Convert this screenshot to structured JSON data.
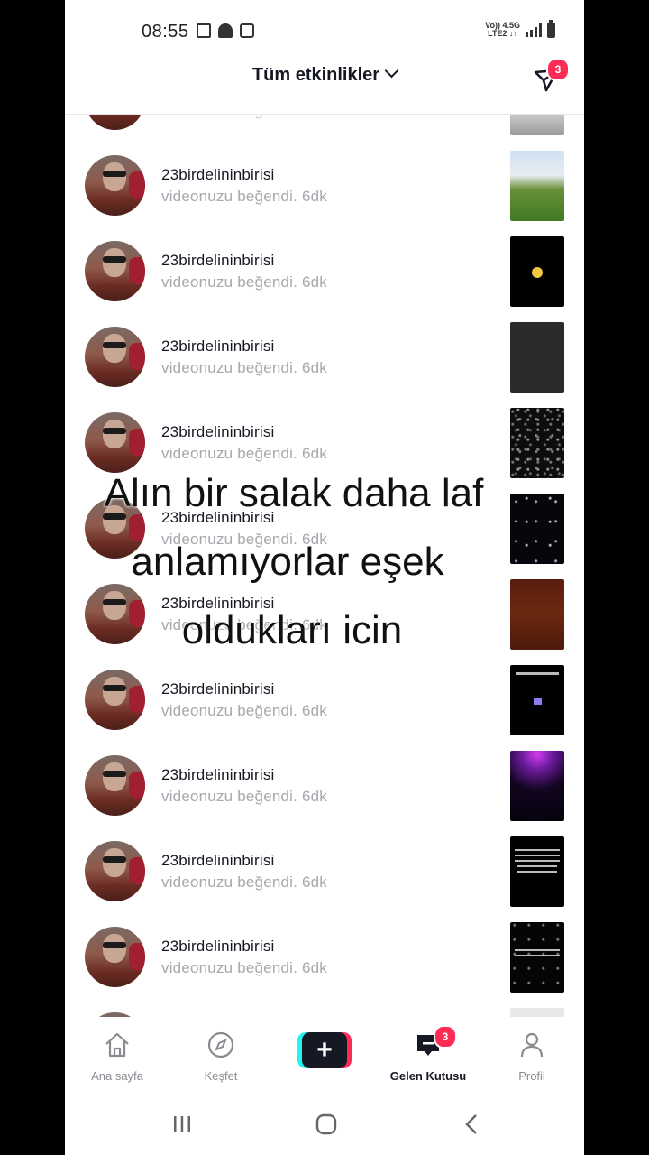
{
  "status_bar": {
    "time": "08:55",
    "network_top": "Vo)) 4.5G",
    "network_bottom": "LTE2 ↓↑"
  },
  "header": {
    "title": "Tüm etkinlikler",
    "dm_badge": "3"
  },
  "notifications": [
    {
      "username": "23birdelininbirisi",
      "action": "videonuzu beğendi.",
      "time": "6dk",
      "thumb": "airplane"
    },
    {
      "username": "23birdelininbirisi",
      "action": "videonuzu beğendi.",
      "time": "6dk",
      "thumb": "emoji"
    },
    {
      "username": "23birdelininbirisi",
      "action": "videonuzu beğendi.",
      "time": "6dk",
      "thumb": "dark-gray"
    },
    {
      "username": "23birdelininbirisi",
      "action": "videonuzu beğendi.",
      "time": "6dk",
      "thumb": "stars"
    },
    {
      "username": "23birdelininbirisi",
      "action": "videonuzu beğendi.",
      "time": "6dk",
      "thumb": "night-sparkle"
    },
    {
      "username": "23birdelininbirisi",
      "action": "videonuzu beğendi.",
      "time": "6dk",
      "thumb": "brown"
    },
    {
      "username": "23birdelininbirisi",
      "action": "videonuzu beğendi.",
      "time": "6dk",
      "thumb": "text-dark"
    },
    {
      "username": "23birdelininbirisi",
      "action": "videonuzu beğendi.",
      "time": "6dk",
      "thumb": "purple-glow"
    },
    {
      "username": "23birdelininbirisi",
      "action": "videonuzu beğendi.",
      "time": "6dk",
      "thumb": "text-black"
    },
    {
      "username": "23birdelininbirisi",
      "action": "videonuzu beğendi.",
      "time": "6dk",
      "thumb": "text-stars"
    }
  ],
  "caption": {
    "line1": "Alın bir salak daha laf",
    "line2": "anlamıyorlar eşek",
    "line3": "oldukları icin"
  },
  "bottom_nav": {
    "home": "Ana sayfa",
    "discover": "Keşfet",
    "create": "+",
    "inbox": "Gelen Kutusu",
    "inbox_badge": "3",
    "profile": "Profil"
  },
  "colors": {
    "accent": "#fe2c55",
    "cyan": "#25f4ee",
    "text_primary": "#161823",
    "text_secondary": "#a7a8ad"
  }
}
